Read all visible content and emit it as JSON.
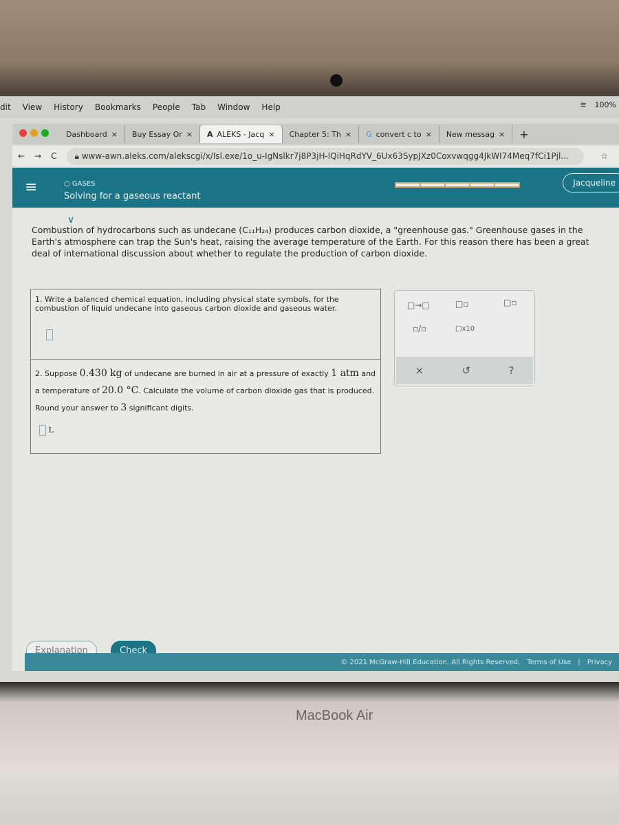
{
  "menubar": {
    "items": [
      "dit",
      "View",
      "History",
      "Bookmarks",
      "People",
      "Tab",
      "Window",
      "Help"
    ],
    "battery": "100%"
  },
  "tabs": [
    {
      "label": "Dashboard"
    },
    {
      "label": "Buy Essay Or"
    },
    {
      "label": "ALEKS - Jacq",
      "active": true
    },
    {
      "label": "Chapter 5: Th"
    },
    {
      "label": "convert c to"
    },
    {
      "label": "New messag"
    }
  ],
  "address": {
    "url": "www-awn.aleks.com/alekscgi/x/Isl.exe/1o_u-IgNslkr7j8P3jH-lQiHqRdYV_6Ux63SypJXz0Coxvwqgg4JkWI74Meq7fCi1Pjl..."
  },
  "header": {
    "topic": "GASES",
    "title": "Solving for a gaseous reactant",
    "user": "Jacqueline",
    "progress_segments": 5,
    "accent": "#1b7386"
  },
  "intro": "Combustion of hydrocarbons such as undecane (C₁₁H₂₄) produces carbon dioxide, a \"greenhouse gas.\" Greenhouse gases in the Earth's atmosphere can trap the Sun's heat, raising the average temperature of the Earth. For this reason there has been a great deal of international discussion about whether to regulate the production of carbon dioxide.",
  "q1": "1. Write a balanced chemical equation, including physical state symbols, for the combustion of liquid undecane into gaseous carbon dioxide and gaseous water.",
  "q2": {
    "p1": "2. Suppose ",
    "mass": "0.430 kg",
    "p2": " of undecane are burned in air at a pressure of exactly ",
    "pressure": "1 atm",
    "p3": " and a temperature of ",
    "temp": "20.0 °C",
    "p4": ". Calculate the volume of carbon dioxide gas that is produced. Round your answer to ",
    "sig": "3",
    "p5": " significant digits.",
    "unit": "L"
  },
  "tools": {
    "x10": "x10",
    "clear": "×",
    "undo": "↺",
    "help": "?"
  },
  "buttons": {
    "explanation": "Explanation",
    "check": "Check"
  },
  "footer": {
    "copyright": "© 2021 McGraw-Hill Education. All Rights Reserved.",
    "terms": "Terms of Use",
    "privacy": "Privacy"
  },
  "device": "MacBook Air"
}
